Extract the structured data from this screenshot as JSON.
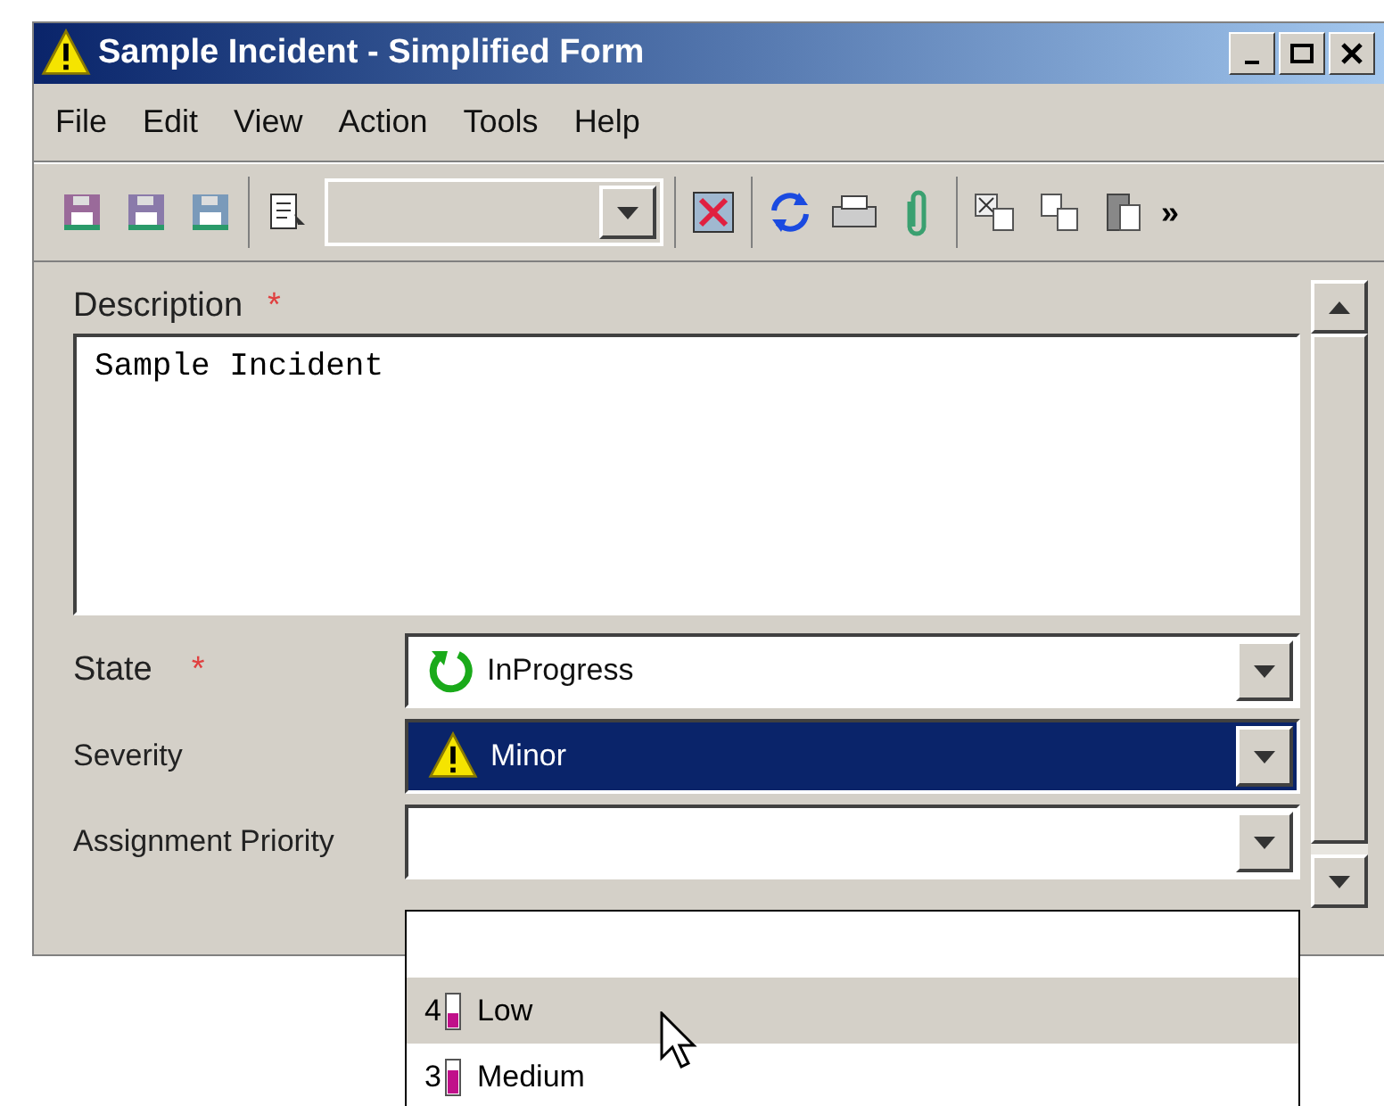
{
  "window": {
    "title": "Sample Incident - Simplified Form"
  },
  "menu": [
    {
      "label": "File"
    },
    {
      "label": "Edit"
    },
    {
      "label": "View"
    },
    {
      "label": "Action"
    },
    {
      "label": "Tools"
    },
    {
      "label": "Help"
    }
  ],
  "toolbar": {
    "overflow": "»"
  },
  "form": {
    "description": {
      "label": "Description",
      "required": "*",
      "value": "Sample Incident"
    },
    "fields": [
      {
        "label": "State",
        "required": "*",
        "value": "InProgress",
        "kind": "state",
        "selected": false
      },
      {
        "label": "Severity",
        "value": "Minor",
        "kind": "warning",
        "selected": true
      },
      {
        "label": "Assignment Priority",
        "kind": "plain",
        "selected": false
      }
    ]
  },
  "dropdown": {
    "options": [
      {
        "number": "4",
        "label": "Low",
        "selected": true
      },
      {
        "number": "3",
        "label": "Medium",
        "selected": false
      }
    ]
  }
}
